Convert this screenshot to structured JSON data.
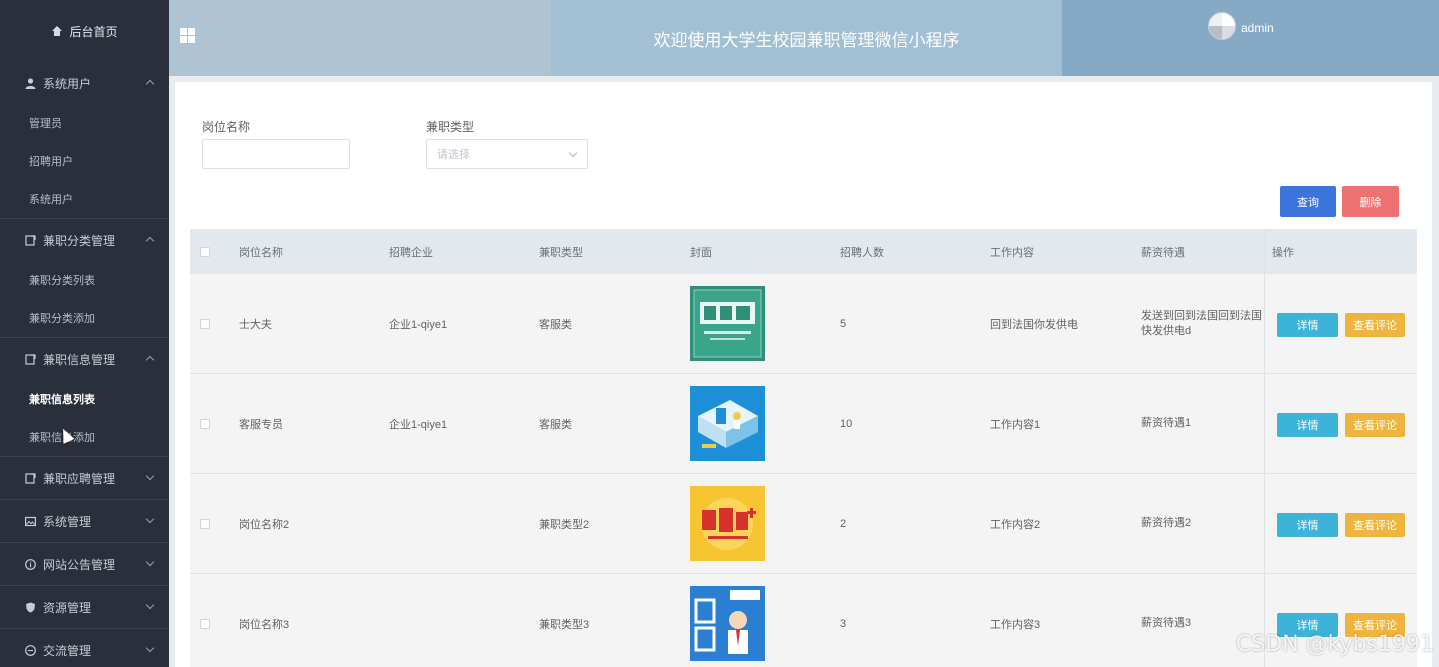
{
  "sidebar": {
    "home": "后台首页",
    "groups": [
      {
        "label": "系统用户",
        "icon": "user-icon",
        "expanded": true,
        "items": [
          {
            "label": "管理员"
          },
          {
            "label": "招聘用户"
          },
          {
            "label": "系统用户"
          }
        ]
      },
      {
        "label": "兼职分类管理",
        "icon": "document-icon",
        "expanded": true,
        "items": [
          {
            "label": "兼职分类列表"
          },
          {
            "label": "兼职分类添加"
          }
        ]
      },
      {
        "label": "兼职信息管理",
        "icon": "document-icon",
        "expanded": true,
        "items": [
          {
            "label": "兼职信息列表",
            "active": true
          },
          {
            "label": "兼职信息添加"
          }
        ]
      },
      {
        "label": "兼职应聘管理",
        "icon": "document-icon",
        "expanded": false,
        "items": []
      },
      {
        "label": "系统管理",
        "icon": "image-icon",
        "expanded": false,
        "items": []
      },
      {
        "label": "网站公告管理",
        "icon": "info-icon",
        "expanded": false,
        "items": []
      },
      {
        "label": "资源管理",
        "icon": "shield-icon",
        "expanded": false,
        "items": []
      },
      {
        "label": "交流管理",
        "icon": "minus-circle-icon",
        "expanded": false,
        "items": []
      }
    ]
  },
  "header": {
    "title": "欢迎使用大学生校园兼职管理微信小程序",
    "username": "admin"
  },
  "filters": {
    "job_name_label": "岗位名称",
    "job_name_value": "",
    "type_label": "兼职类型",
    "type_placeholder": "请选择"
  },
  "actions": {
    "query": "查询",
    "delete": "删除"
  },
  "table": {
    "columns": [
      "岗位名称",
      "招聘企业",
      "兼职类型",
      "封面",
      "招聘人数",
      "工作内容",
      "薪资待遇",
      "操作"
    ],
    "row_actions": {
      "detail": "详情",
      "review": "查看评论"
    },
    "rows": [
      {
        "name": "士大夫",
        "company": "企业1-qiye1",
        "type": "客服类",
        "cover": "cover-recruit",
        "count": "5",
        "content": "回到法国你发供电",
        "reward": "发送到回到法国回到法国快发供电d"
      },
      {
        "name": "客服专员",
        "company": "企业1-qiye1",
        "type": "客服类",
        "cover": "cover-isometric",
        "count": "10",
        "content": "工作内容1",
        "reward": "薪资待遇1"
      },
      {
        "name": "岗位名称2",
        "company": "",
        "type": "兼职类型2",
        "cover": "cover-yellow",
        "count": "2",
        "content": "工作内容2",
        "reward": "薪资待遇2"
      },
      {
        "name": "岗位名称3",
        "company": "",
        "type": "兼职类型3",
        "cover": "cover-maka",
        "count": "3",
        "content": "工作内容3",
        "reward": "薪资待遇3"
      }
    ]
  },
  "watermark": "CSDN @kybs1991",
  "colors": {
    "sidebar_bg": "#2a2f3c",
    "header_left": "#afc4d3",
    "header_mid": "#a3bfd4",
    "header_right": "#86a9c6",
    "query_btn": "#3b75db",
    "delete_btn": "#ed7171",
    "detail_btn": "#3cb4d9",
    "review_btn": "#efb43e"
  }
}
